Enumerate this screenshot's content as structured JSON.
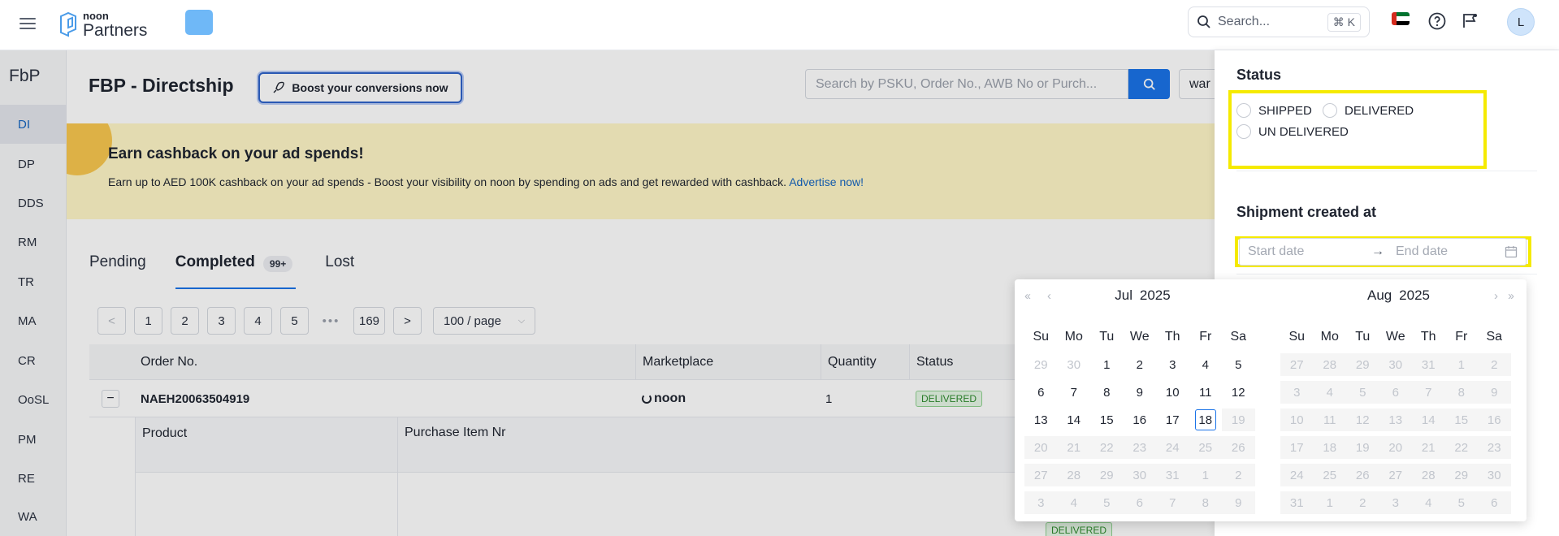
{
  "topbar": {
    "logo_small": "noon",
    "logo_big": "Partners",
    "search_placeholder": "Search...",
    "search_shortcut": "⌘ K",
    "avatar_letter": "L"
  },
  "sidebar": {
    "title": "FbP",
    "items": [
      "DI",
      "DP",
      "DDS",
      "RM",
      "TR",
      "MA",
      "CR",
      "OoSL",
      "PM",
      "RE",
      "WA"
    ],
    "active_index": 0
  },
  "main": {
    "page_title": "FBP - Directship",
    "boost_label": "Boost your conversions now",
    "order_search_placeholder": "Search by PSKU, Order No., AWB No or Purch...",
    "warehouse_select": "war"
  },
  "banner": {
    "title": "Earn cashback on your ad spends!",
    "description": "Earn up to AED 100K cashback on your ad spends - Boost your visibility on noon by spending on ads and get rewarded with cashback.",
    "link": "Advertise now!"
  },
  "tabs": [
    {
      "label": "Pending"
    },
    {
      "label": "Completed",
      "badge": "99+"
    },
    {
      "label": "Lost"
    }
  ],
  "pagination": {
    "prev": "<",
    "pages": [
      "1",
      "2",
      "3",
      "4",
      "5"
    ],
    "dots": "•••",
    "last": "169",
    "next": ">",
    "page_size": "100 / page"
  },
  "table": {
    "headers": [
      "Order No.",
      "Marketplace",
      "Quantity",
      "Status"
    ],
    "row": {
      "order_no": "NAEH20063504919",
      "marketplace": "noon",
      "quantity": "1",
      "status": "DELIVERED"
    },
    "sub_headers": [
      "Product",
      "Purchase Item Nr"
    ],
    "sub_status": "DELIVERED"
  },
  "drawer": {
    "status_title": "Status",
    "status_options": [
      "SHIPPED",
      "DELIVERED",
      "UN DELIVERED"
    ],
    "date_title": "Shipment created at",
    "start_placeholder": "Start date",
    "end_placeholder": "End date",
    "highlight_color": "#f5ea00"
  },
  "calendar": {
    "weekdays": [
      "Su",
      "Mo",
      "Tu",
      "We",
      "Th",
      "Fr",
      "Sa"
    ],
    "today": "18",
    "months": [
      {
        "month": "Jul",
        "year": "2025",
        "days": [
          [
            "29",
            "out"
          ],
          [
            "30",
            "out"
          ],
          [
            "1",
            ""
          ],
          [
            "2",
            ""
          ],
          [
            "3",
            ""
          ],
          [
            "4",
            ""
          ],
          [
            "5",
            ""
          ],
          [
            "6",
            ""
          ],
          [
            "7",
            ""
          ],
          [
            "8",
            ""
          ],
          [
            "9",
            ""
          ],
          [
            "10",
            ""
          ],
          [
            "11",
            ""
          ],
          [
            "12",
            ""
          ],
          [
            "13",
            ""
          ],
          [
            "14",
            ""
          ],
          [
            "15",
            ""
          ],
          [
            "16",
            ""
          ],
          [
            "17",
            ""
          ],
          [
            "18",
            "today"
          ],
          [
            "19",
            "dis"
          ],
          [
            "20",
            "dis"
          ],
          [
            "21",
            "dis"
          ],
          [
            "22",
            "dis"
          ],
          [
            "23",
            "dis"
          ],
          [
            "24",
            "dis"
          ],
          [
            "25",
            "dis"
          ],
          [
            "26",
            "dis"
          ],
          [
            "27",
            "dis"
          ],
          [
            "28",
            "dis"
          ],
          [
            "29",
            "dis"
          ],
          [
            "30",
            "dis"
          ],
          [
            "31",
            "dis"
          ],
          [
            "1",
            "dis"
          ],
          [
            "2",
            "dis"
          ],
          [
            "3",
            "dis"
          ],
          [
            "4",
            "dis"
          ],
          [
            "5",
            "dis"
          ],
          [
            "6",
            "dis"
          ],
          [
            "7",
            "dis"
          ],
          [
            "8",
            "dis"
          ],
          [
            "9",
            "dis"
          ]
        ]
      },
      {
        "month": "Aug",
        "year": "2025",
        "days": [
          [
            "27",
            "dis"
          ],
          [
            "28",
            "dis"
          ],
          [
            "29",
            "dis"
          ],
          [
            "30",
            "dis"
          ],
          [
            "31",
            "dis"
          ],
          [
            "1",
            "dis"
          ],
          [
            "2",
            "dis"
          ],
          [
            "3",
            "dis"
          ],
          [
            "4",
            "dis"
          ],
          [
            "5",
            "dis"
          ],
          [
            "6",
            "dis"
          ],
          [
            "7",
            "dis"
          ],
          [
            "8",
            "dis"
          ],
          [
            "9",
            "dis"
          ],
          [
            "10",
            "dis"
          ],
          [
            "11",
            "dis"
          ],
          [
            "12",
            "dis"
          ],
          [
            "13",
            "dis"
          ],
          [
            "14",
            "dis"
          ],
          [
            "15",
            "dis"
          ],
          [
            "16",
            "dis"
          ],
          [
            "17",
            "dis"
          ],
          [
            "18",
            "dis"
          ],
          [
            "19",
            "dis"
          ],
          [
            "20",
            "dis"
          ],
          [
            "21",
            "dis"
          ],
          [
            "22",
            "dis"
          ],
          [
            "23",
            "dis"
          ],
          [
            "24",
            "dis"
          ],
          [
            "25",
            "dis"
          ],
          [
            "26",
            "dis"
          ],
          [
            "27",
            "dis"
          ],
          [
            "28",
            "dis"
          ],
          [
            "29",
            "dis"
          ],
          [
            "30",
            "dis"
          ],
          [
            "31",
            "dis"
          ],
          [
            "1",
            "dis"
          ],
          [
            "2",
            "dis"
          ],
          [
            "3",
            "dis"
          ],
          [
            "4",
            "dis"
          ],
          [
            "5",
            "dis"
          ],
          [
            "6",
            "dis"
          ]
        ]
      }
    ]
  }
}
